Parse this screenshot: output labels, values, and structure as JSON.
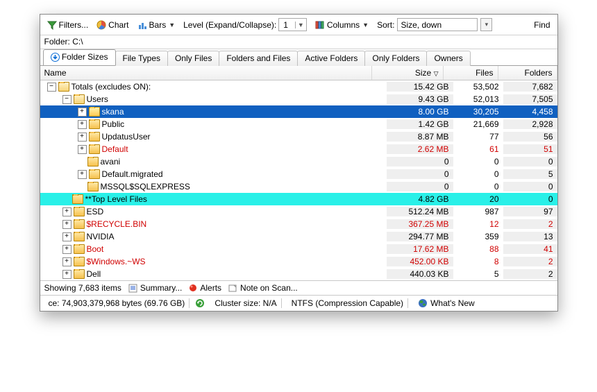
{
  "toolbar": {
    "filters": "Filters...",
    "chart": "Chart",
    "bars": "Bars",
    "level_label": "Level (Expand/Collapse):",
    "level_value": "1",
    "columns": "Columns",
    "sort_label": "Sort:",
    "sort_value": "Size, down",
    "find": "Find"
  },
  "folder_label": "Folder:",
  "folder_path": "C:\\",
  "tabs": [
    "Folder Sizes",
    "File Types",
    "Only Files",
    "Folders and Files",
    "Active Folders",
    "Only Folders",
    "Owners"
  ],
  "active_tab": 0,
  "columns": {
    "name": "Name",
    "size": "Size",
    "files": "Files",
    "folders": "Folders"
  },
  "rows": [
    {
      "indent": 0,
      "exp": "-",
      "name": "Totals (excludes ON):",
      "size": "15.42 GB",
      "files": "53,502",
      "folders": "7,682",
      "icon": "open"
    },
    {
      "indent": 1,
      "exp": "-",
      "name": "Users",
      "size": "9.43 GB",
      "files": "52,013",
      "folders": "7,505",
      "icon": "open"
    },
    {
      "indent": 2,
      "exp": "+",
      "name": "skana",
      "size": "8.00 GB",
      "files": "30,205",
      "folders": "4,458",
      "icon": "closed",
      "sel": true
    },
    {
      "indent": 2,
      "exp": "+",
      "name": "Public",
      "size": "1.42 GB",
      "files": "21,669",
      "folders": "2,928",
      "icon": "closed"
    },
    {
      "indent": 2,
      "exp": "+",
      "name": "UpdatusUser",
      "size": "8.87 MB",
      "files": "77",
      "folders": "56",
      "icon": "closed"
    },
    {
      "indent": 2,
      "exp": "+",
      "name": "Default",
      "size": "2.62 MB",
      "files": "61",
      "folders": "51",
      "icon": "closed",
      "red": true
    },
    {
      "indent": 2,
      "exp": "",
      "name": "avani",
      "size": "0",
      "files": "0",
      "folders": "0",
      "icon": "closed"
    },
    {
      "indent": 2,
      "exp": "+",
      "name": "Default.migrated",
      "size": "0",
      "files": "0",
      "folders": "5",
      "icon": "closed"
    },
    {
      "indent": 2,
      "exp": "",
      "name": "MSSQL$SQLEXPRESS",
      "size": "0",
      "files": "0",
      "folders": "0",
      "icon": "closed"
    },
    {
      "indent": 1,
      "exp": "",
      "name": "**Top Level Files",
      "size": "4.82 GB",
      "files": "20",
      "folders": "0",
      "icon": "closed",
      "cyan": true
    },
    {
      "indent": 1,
      "exp": "+",
      "name": "ESD",
      "size": "512.24 MB",
      "files": "987",
      "folders": "97",
      "icon": "closed"
    },
    {
      "indent": 1,
      "exp": "+",
      "name": "$RECYCLE.BIN",
      "size": "367.25 MB",
      "files": "12",
      "folders": "2",
      "icon": "closed",
      "red": true
    },
    {
      "indent": 1,
      "exp": "+",
      "name": "NVIDIA",
      "size": "294.77 MB",
      "files": "359",
      "folders": "13",
      "icon": "closed"
    },
    {
      "indent": 1,
      "exp": "+",
      "name": "Boot",
      "size": "17.62 MB",
      "files": "88",
      "folders": "41",
      "icon": "closed",
      "red": true
    },
    {
      "indent": 1,
      "exp": "+",
      "name": "$Windows.~WS",
      "size": "452.00 KB",
      "files": "8",
      "folders": "2",
      "icon": "closed",
      "red": true
    },
    {
      "indent": 1,
      "exp": "+",
      "name": "Dell",
      "size": "440.03 KB",
      "files": "5",
      "folders": "2",
      "icon": "closed"
    }
  ],
  "status": {
    "showing": "Showing 7,683 items",
    "summary": "Summary...",
    "alerts": "Alerts",
    "note": "Note on Scan..."
  },
  "bottom": {
    "free": "ce: 74,903,379,968 bytes (69.76 GB)",
    "cluster": "Cluster size: N/A",
    "fs": "NTFS (Compression Capable)",
    "whatsnew": "What's New"
  }
}
